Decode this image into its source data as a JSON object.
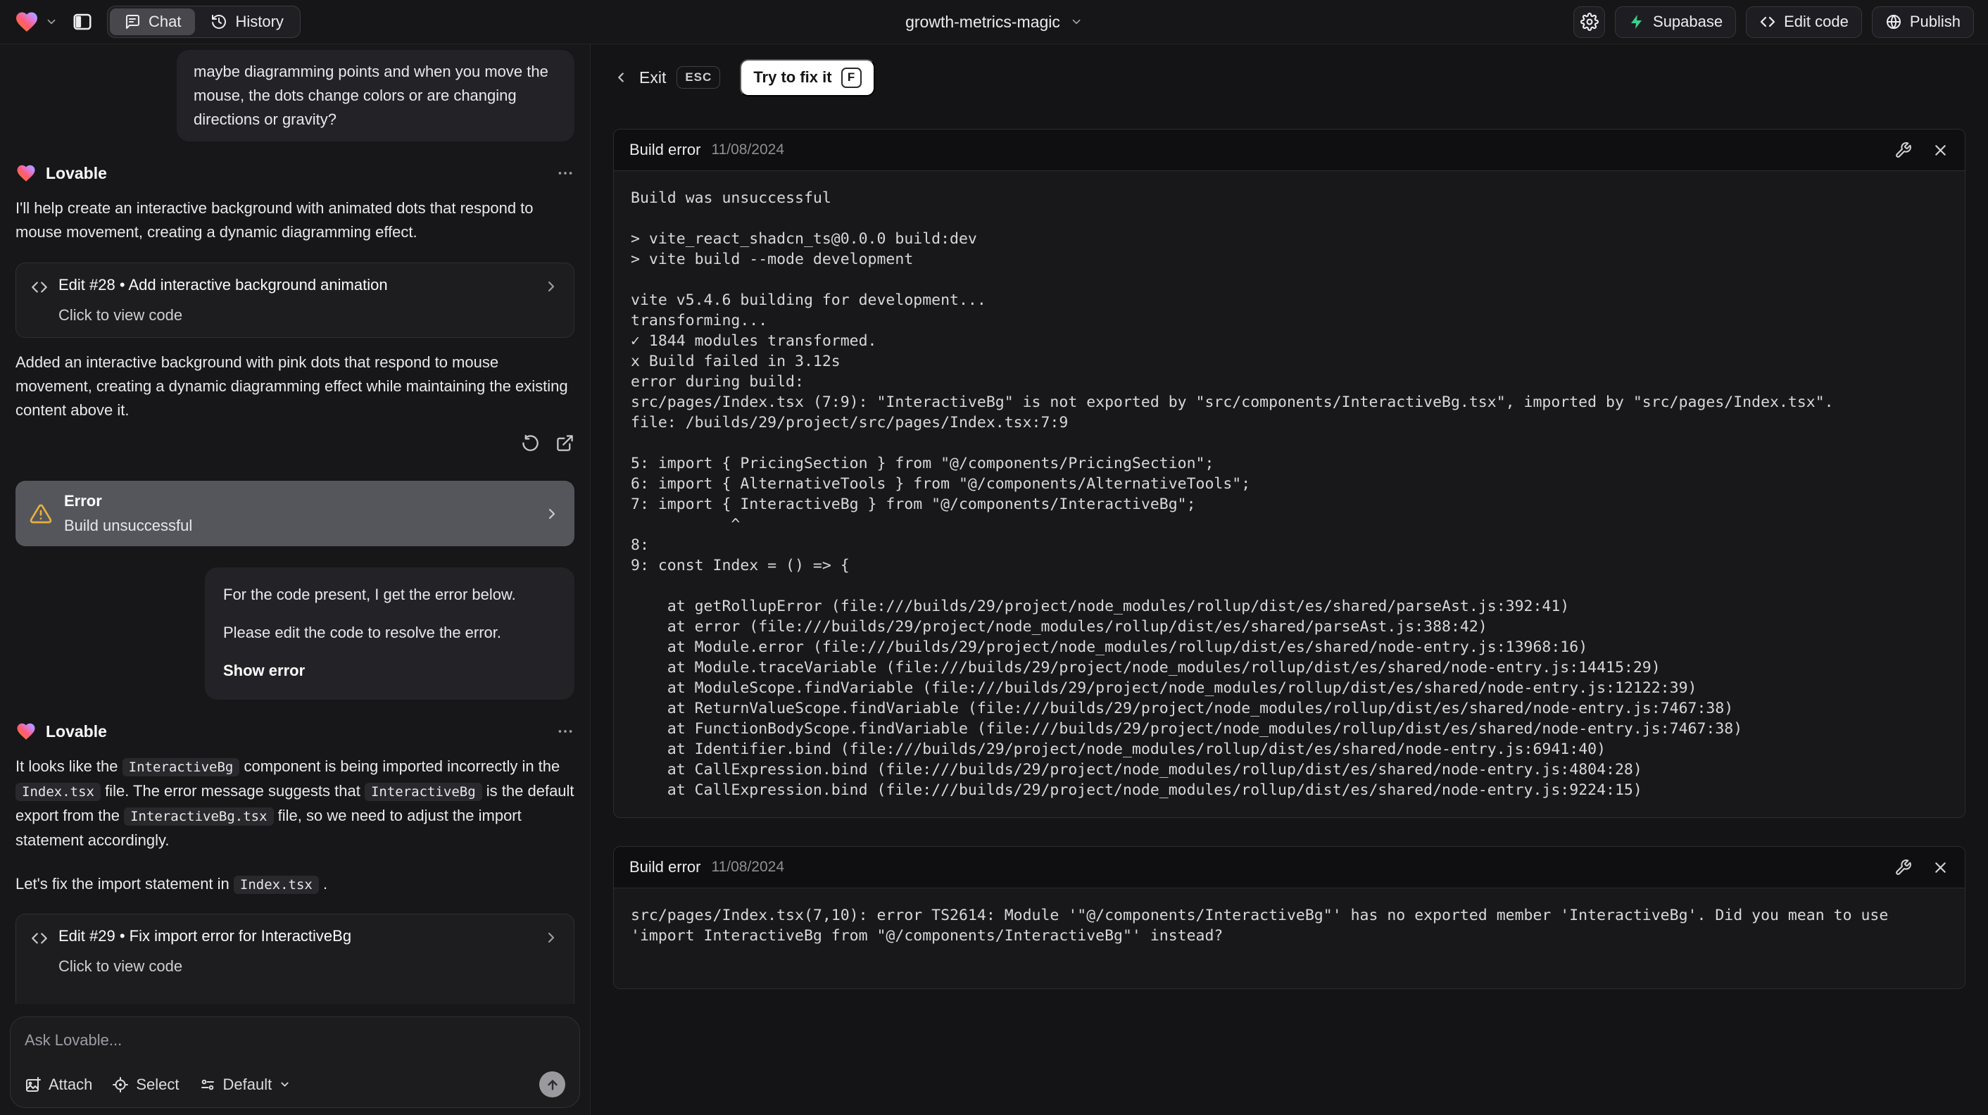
{
  "topbar": {
    "project_name": "growth-metrics-magic",
    "tabs": [
      {
        "label": "Chat"
      },
      {
        "label": "History"
      }
    ],
    "actions": {
      "supabase": "Supabase",
      "edit_code": "Edit code",
      "publish": "Publish"
    }
  },
  "chat": {
    "assistant_name": "Lovable",
    "user_message_1": "maybe diagramming points and when you move the mouse, the dots change colors or are changing directions or gravity?",
    "message_1": "I'll help create an interactive background with animated dots that respond to mouse movement, creating a dynamic diagramming effect.",
    "edit_card_1": {
      "title": "Edit #28 • Add interactive background animation",
      "subtitle": "Click to view code"
    },
    "message_2": "Added an interactive background with pink dots that respond to mouse movement, creating a dynamic diagramming effect while maintaining the existing content above it.",
    "error_card": {
      "title": "Error",
      "subtitle": "Build unsuccessful"
    },
    "user_message_2": {
      "p1": "For the code present, I get the error below.",
      "p2": "Please edit the code to resolve the error.",
      "p3": "Show error"
    },
    "message_3_rich": [
      {
        "v": "It looks like the "
      },
      {
        "v": "InteractiveBg",
        "c": true
      },
      {
        "v": " component is being imported incorrectly in the "
      },
      {
        "v": "Index.tsx",
        "c": true
      },
      {
        "v": " file. The error message suggests that "
      },
      {
        "v": "InteractiveBg",
        "c": true
      },
      {
        "v": " is the default export from the "
      },
      {
        "v": "InteractiveBg.tsx",
        "c": true
      },
      {
        "v": " file, so we need to adjust the import statement accordingly."
      }
    ],
    "message_4_rich": [
      {
        "v": "Let's fix the import statement in "
      },
      {
        "v": "Index.tsx",
        "c": true
      },
      {
        "v": " ."
      }
    ],
    "edit_card_2": {
      "title": "Edit #29 • Fix import error for InteractiveBg",
      "subtitle": "Click to view code"
    },
    "input": {
      "placeholder": "Ask Lovable...",
      "attach": "Attach",
      "select": "Select",
      "mode": "Default"
    }
  },
  "fixbar": {
    "exit": "Exit",
    "esc": "ESC",
    "fix": "Try to fix it",
    "key": "F"
  },
  "panels": [
    {
      "title": "Build error",
      "date": "11/08/2024",
      "log": [
        "Build was unsuccessful",
        "",
        "> vite_react_shadcn_ts@0.0.0 build:dev",
        "> vite build --mode development",
        "",
        "vite v5.4.6 building for development...",
        "transforming...",
        "✓ 1844 modules transformed.",
        "x Build failed in 3.12s",
        "error during build:",
        "src/pages/Index.tsx (7:9): \"InteractiveBg\" is not exported by \"src/components/InteractiveBg.tsx\", imported by \"src/pages/Index.tsx\".",
        "file: /builds/29/project/src/pages/Index.tsx:7:9",
        "",
        "5: import { PricingSection } from \"@/components/PricingSection\";",
        "6: import { AlternativeTools } from \"@/components/AlternativeTools\";",
        "7: import { InteractiveBg } from \"@/components/InteractiveBg\";",
        "           ^",
        "8: ",
        "9: const Index = () => {",
        "",
        "    at getRollupError (file:///builds/29/project/node_modules/rollup/dist/es/shared/parseAst.js:392:41)",
        "    at error (file:///builds/29/project/node_modules/rollup/dist/es/shared/parseAst.js:388:42)",
        "    at Module.error (file:///builds/29/project/node_modules/rollup/dist/es/shared/node-entry.js:13968:16)",
        "    at Module.traceVariable (file:///builds/29/project/node_modules/rollup/dist/es/shared/node-entry.js:14415:29)",
        "    at ModuleScope.findVariable (file:///builds/29/project/node_modules/rollup/dist/es/shared/node-entry.js:12122:39)",
        "    at ReturnValueScope.findVariable (file:///builds/29/project/node_modules/rollup/dist/es/shared/node-entry.js:7467:38)",
        "    at FunctionBodyScope.findVariable (file:///builds/29/project/node_modules/rollup/dist/es/shared/node-entry.js:7467:38)",
        "    at Identifier.bind (file:///builds/29/project/node_modules/rollup/dist/es/shared/node-entry.js:6941:40)",
        "    at CallExpression.bind (file:///builds/29/project/node_modules/rollup/dist/es/shared/node-entry.js:4804:28)",
        "    at CallExpression.bind (file:///builds/29/project/node_modules/rollup/dist/es/shared/node-entry.js:9224:15)"
      ]
    },
    {
      "title": "Build error",
      "date": "11/08/2024",
      "log": [
        "src/pages/Index.tsx(7,10): error TS2614: Module '\"@/components/InteractiveBg\"' has no exported member 'InteractiveBg'. Did you mean to use 'import InteractiveBg from \"@/components/InteractiveBg\"' instead?"
      ]
    }
  ],
  "colors": {
    "warning": "#e7b13e",
    "supabase_green": "#3ecf8e",
    "fix_pill_bg": "#ffffff",
    "error_card_bg": "#55565c"
  }
}
